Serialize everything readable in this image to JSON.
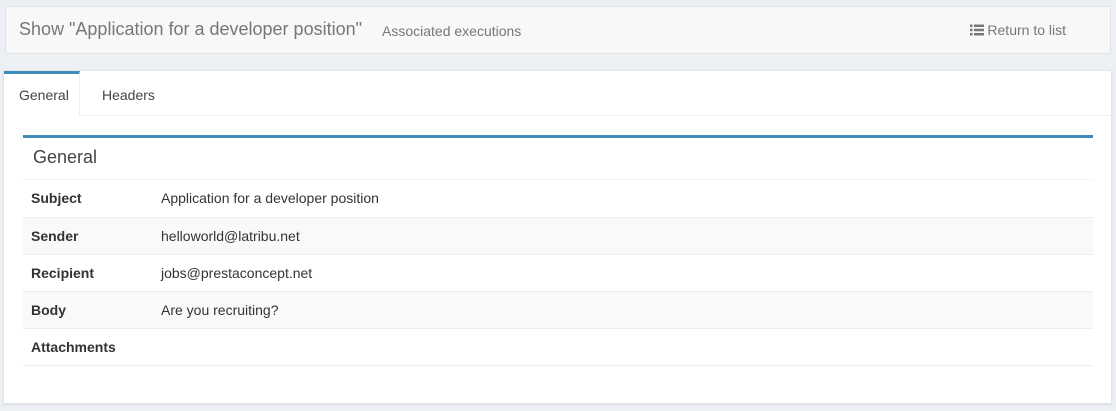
{
  "header": {
    "title": "Show \"Application for a developer position\"",
    "associated_link": "Associated executions",
    "return_link": "Return to list"
  },
  "tabs": [
    {
      "label": "General",
      "active": true
    },
    {
      "label": "Headers",
      "active": false
    }
  ],
  "panel": {
    "title": "General",
    "rows": [
      {
        "label": "Subject",
        "value": "Application for a developer position"
      },
      {
        "label": "Sender",
        "value": "helloworld@latribu.net"
      },
      {
        "label": "Recipient",
        "value": "jobs@prestaconcept.net"
      },
      {
        "label": "Body",
        "value": "Are you recruiting?"
      },
      {
        "label": "Attachments",
        "value": ""
      }
    ]
  },
  "colors": {
    "accent": "#3c8dbc",
    "background": "#ecf0f5",
    "muted_text": "#777777"
  },
  "icons": {
    "return": "list-icon"
  }
}
